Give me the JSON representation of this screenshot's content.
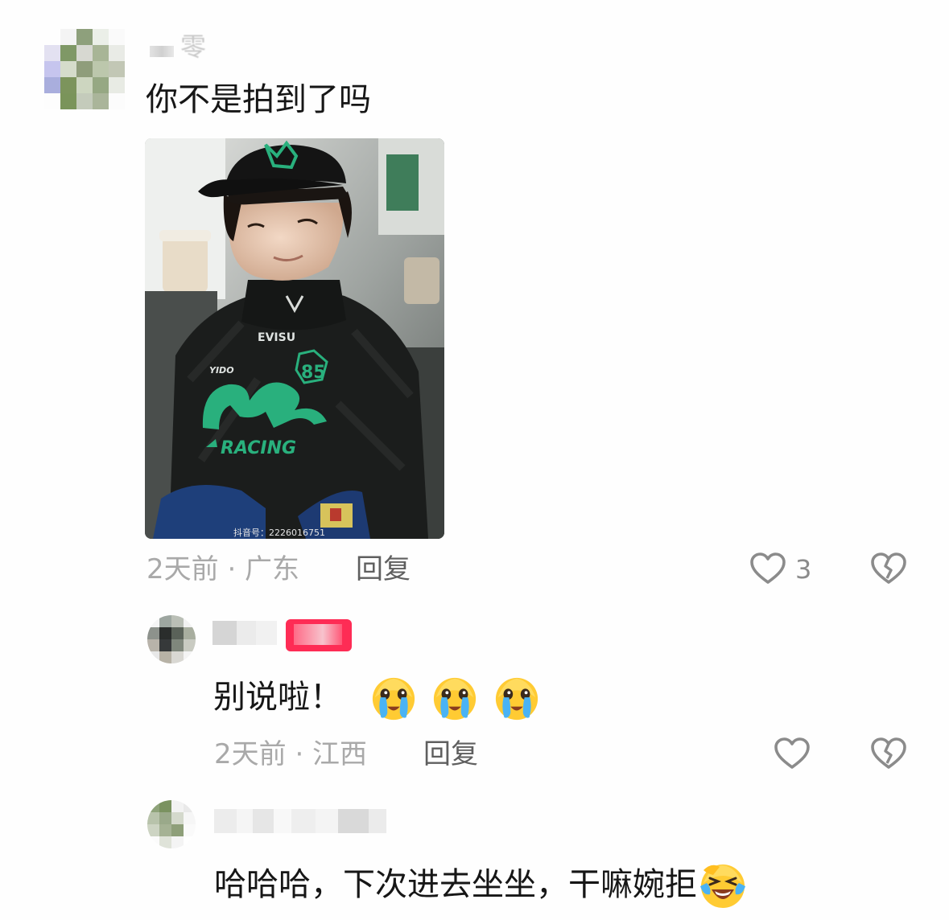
{
  "comments": [
    {
      "username_visible": "零",
      "text": "你不是拍到了吗",
      "meta": "2天前 · 广东",
      "reply_label": "回复",
      "like_count": "3",
      "image": {
        "subject": "person in black cap and black racing suit",
        "shirt_texts": [
          "EVISU",
          "RACING",
          "85",
          "YIDO"
        ],
        "watermark": "抖音号：2226016751"
      }
    },
    {
      "text": "别说啦！",
      "emojis": [
        "crying-emoji",
        "crying-emoji",
        "crying-emoji"
      ],
      "meta": "2天前 · 江西",
      "reply_label": "回复",
      "like_count": ""
    },
    {
      "text": "哈哈哈，下次进去坐坐，干嘛婉拒",
      "emojis": [
        "laughing-crying-emoji"
      ]
    }
  ],
  "colors": {
    "background": "#fefefe",
    "text": "#161616",
    "meta": "#a9a9a9",
    "reply": "#5f5f5f",
    "icon": "#8b8b8b",
    "author_badge": "#fe2c55",
    "suit_green": "#29b07d"
  }
}
